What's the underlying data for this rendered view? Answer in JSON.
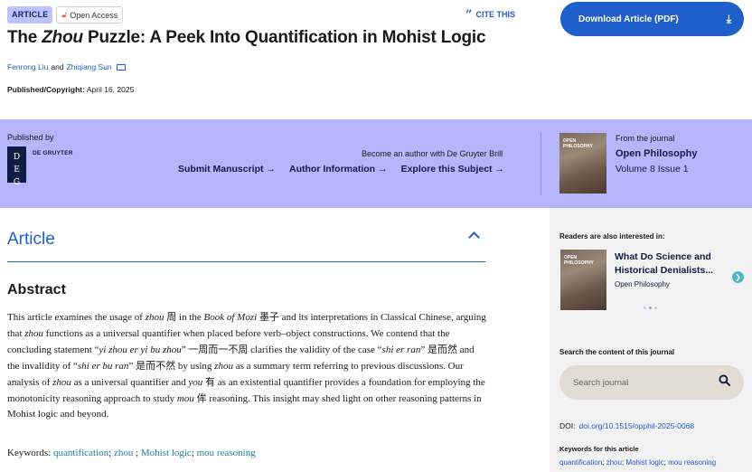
{
  "header": {
    "badge_article": "ARTICLE",
    "badge_open_access": "Open Access",
    "cite_label": "CITE THIS",
    "title_pre": "The ",
    "title_em": "Zhou",
    "title_post": " Puzzle: A Peek Into Quantification in Mohist Logic",
    "author1": "Fenrong Liu",
    "author_sep": "and",
    "author2": "Zhiqiang Sun",
    "pub_label": "Published/Copyright:",
    "pub_date": "April 16, 2025",
    "download_label": "Download Article (PDF)"
  },
  "band": {
    "published_by": "Published by",
    "publisher_logo_letters": [
      "D",
      "E",
      "G"
    ],
    "publisher_name": "DE GRUYTER",
    "become_author": "Become an author with De Gruyter Brill",
    "links": [
      "Submit Manuscript",
      "Author Information",
      "Explore this Subject"
    ],
    "from_journal": "From the journal",
    "journal_name": "Open Philosophy",
    "journal_volume": "Volume 8 Issue 1",
    "cover_text": "OPEN PHILOSOPHY"
  },
  "main": {
    "section_title": "Article",
    "abstract_title": "Abstract",
    "abstract_parts": [
      "This article examines the usage of ",
      "zhou",
      " 周 in the ",
      "Book of Mozi",
      " 墨子 and its interpretations in Classical Chinese, arguing that ",
      "zhou",
      " functions as a universal quantifier when placed before verb–object constructions. We contend that the concluding statement “",
      "yi zhou er yi bu zhou",
      "” 一周而一不周 clarifies the validity of the case “",
      "shi er ran",
      "” 是而然 and the invalidity of “",
      "shi er bu ran",
      "” 是而不然 by using ",
      "zhou",
      " as a summary term referring to previous discussions. Our analysis of ",
      "zhou",
      " as a universal quantifier and ",
      "you",
      " 有 as an existential quantifier provides a foundation for employing the monotonicity reasoning approach to study ",
      "mou",
      " 侔 reasoning. This insight may shed light on other reasoning patterns in Mohist logic and beyond."
    ],
    "keywords_label": "Keywords:",
    "keywords": [
      "quantification",
      "zhou",
      "Mohist logic",
      "mou reasoning"
    ]
  },
  "sidebar": {
    "readers_heading": "Readers are also interested in:",
    "rec_title": "What Do Science and Historical Denialists...",
    "rec_journal": "Open Philosophy",
    "rec_cover_text": "OPEN PHILOSOPHY",
    "search_heading": "Search the content of this journal",
    "search_placeholder": "Search journal",
    "doi_label": "DOI:",
    "doi_value": "doi.org/10.1515/opphil-2025-0068",
    "kw_heading": "Keywords for this article",
    "kw_items": [
      "quantification",
      "zhou",
      "Mohist logic",
      "mou reasoning"
    ]
  },
  "colors": {
    "accent": "#1f5fcc",
    "band": "#b4b5fb",
    "badge": "#bcc1ff",
    "navy": "#0f1d45",
    "keyword_teal": "#1f7fa0"
  },
  "icons": [
    "lock-icon",
    "quote-icon",
    "download-icon",
    "mail-icon",
    "arrow-right-icon",
    "chevron-up-icon",
    "chevron-right-icon",
    "search-icon"
  ]
}
